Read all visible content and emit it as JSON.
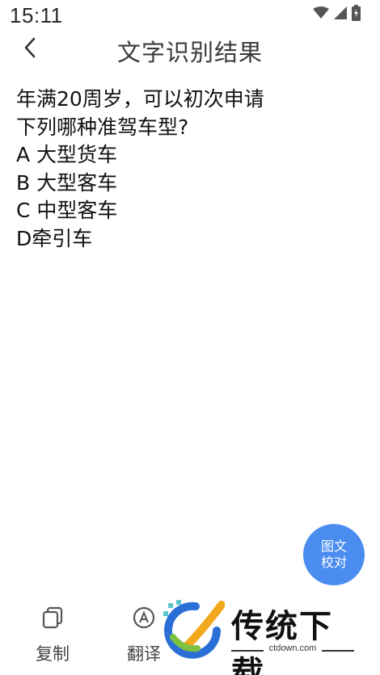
{
  "status_bar": {
    "time": "15:11",
    "icons": [
      "wifi-icon",
      "signal-icon",
      "battery-icon"
    ]
  },
  "header": {
    "title": "文字识别结果",
    "back_icon": "chevron-left-icon"
  },
  "result": {
    "lines": [
      "年满20周岁，可以初次申请",
      "下列哪种准驾车型?",
      "A 大型货车",
      "B 大型客车",
      "C 中型客车",
      "D牵引车"
    ]
  },
  "fab": {
    "line1": "图文",
    "line2": "校对",
    "color": "#4a8cf0"
  },
  "bottom_bar": {
    "copy_label": "复制",
    "translate_label": "翻译"
  },
  "watermark": {
    "title": "传统下载",
    "url": "ctdown.com"
  }
}
